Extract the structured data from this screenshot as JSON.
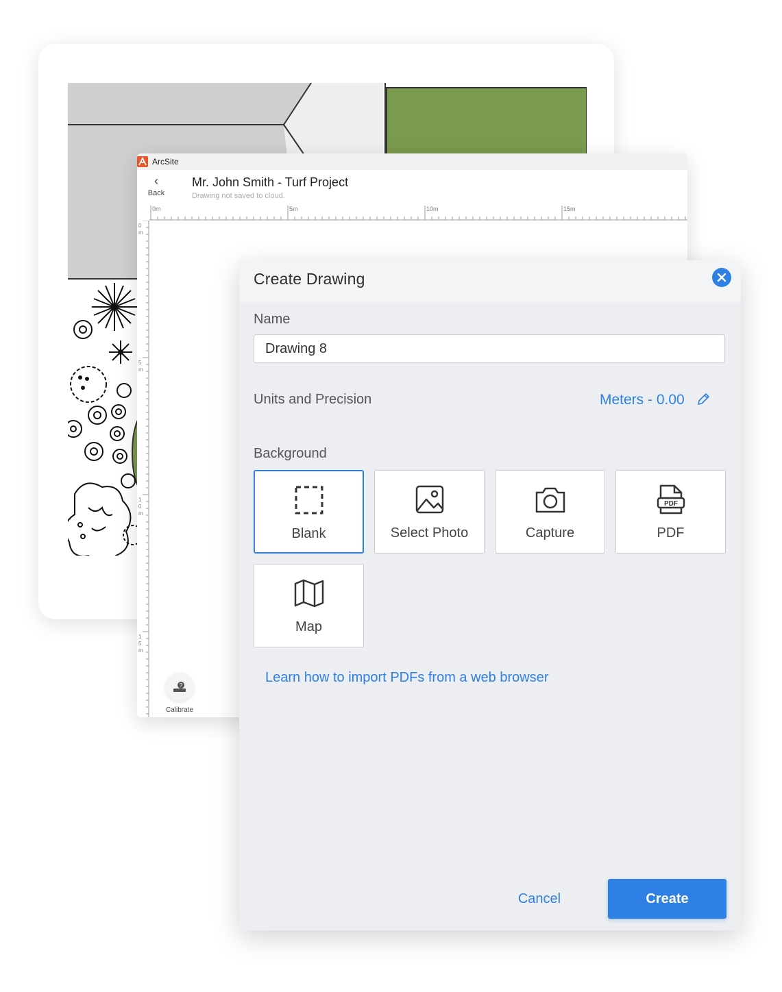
{
  "app": {
    "name": "ArcSite",
    "back_label": "Back",
    "doc_title": "Mr. John Smith - Turf Project",
    "doc_subtitle": "Drawing not saved to cloud.",
    "calibrate_label": "Calibrate",
    "ruler_h_ticks": [
      "0m",
      "5m",
      "10m",
      "15m"
    ],
    "ruler_v_ticks": [
      "0",
      "m",
      "5",
      "m",
      "1",
      "0",
      "m",
      "1",
      "5",
      "m"
    ]
  },
  "dialog": {
    "title": "Create Drawing",
    "name_label": "Name",
    "name_value": "Drawing 8",
    "units_label": "Units and Precision",
    "units_value": "Meters - 0.00",
    "background_label": "Background",
    "options": [
      {
        "label": "Blank",
        "icon": "blank-icon",
        "selected": true
      },
      {
        "label": "Select Photo",
        "icon": "photo-icon",
        "selected": false
      },
      {
        "label": "Capture",
        "icon": "camera-icon",
        "selected": false
      },
      {
        "label": "PDF",
        "icon": "pdf-icon",
        "selected": false
      },
      {
        "label": "Map",
        "icon": "map-icon",
        "selected": false
      }
    ],
    "pdf_badge": "PDF",
    "learn_link": "Learn how to import PDFs from a web browser",
    "cancel_label": "Cancel",
    "create_label": "Create"
  },
  "colors": {
    "accent": "#2f80e4",
    "turf": "#7a9a4e",
    "paving": "#cfcfcf"
  }
}
